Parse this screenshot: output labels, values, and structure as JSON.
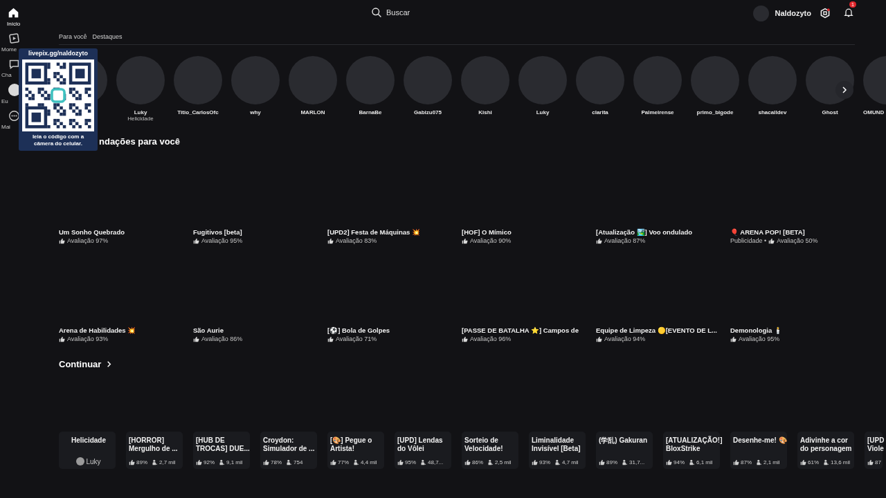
{
  "sidebar": {
    "items": [
      {
        "label": "Início",
        "selected": true
      },
      {
        "label": "Mome",
        "selected": false
      },
      {
        "label": "Cha",
        "selected": false
      },
      {
        "label": "Eu",
        "selected": false
      },
      {
        "label": "Mai",
        "selected": false
      }
    ]
  },
  "search": {
    "placeholder": "Buscar"
  },
  "user": {
    "name": "Naldozyto",
    "notifications": "1"
  },
  "tabs": [
    {
      "label": "Para você",
      "selected": false
    },
    {
      "label": "Destaques",
      "selected": false
    }
  ],
  "friends": [
    {
      "name": "Luky",
      "status": "Helicidade"
    },
    {
      "name": "Titio_CarlosOfc"
    },
    {
      "name": "why"
    },
    {
      "name": "MARLON"
    },
    {
      "name": "BarnaBe"
    },
    {
      "name": "Gabizu075"
    },
    {
      "name": "Kishi"
    },
    {
      "name": "Luky"
    },
    {
      "name": "clarita"
    },
    {
      "name": "Palmeirense"
    },
    {
      "name": "primo_bigode"
    },
    {
      "name": "shacalldev"
    },
    {
      "name": "Ghost"
    },
    {
      "name": "OMUND"
    }
  ],
  "recommended": {
    "title": "ndações para você",
    "games": [
      {
        "title": "Um Sonho Quebrado",
        "rating": "Avaliação 97%"
      },
      {
        "title": "Fugitivos [beta]",
        "rating": "Avaliação 95%"
      },
      {
        "title": "[UPD2] Festa de Máquinas 💥",
        "rating": "Avaliação 83%"
      },
      {
        "title": "[HOF] O Mímico",
        "rating": "Avaliação 90%"
      },
      {
        "title": "[Atualização 🏞️] Voo ondulado",
        "rating": "Avaliação 87%"
      },
      {
        "title": "🎈 ARENA POP! [BETA]",
        "ad": "Publicidade •",
        "rating": "Avaliação 50%"
      },
      {
        "title": "Arena de Habilidades 💥",
        "rating": "Avaliação 93%"
      },
      {
        "title": "São Aurie",
        "rating": "Avaliação 86%"
      },
      {
        "title": "[⚽] Bola de Golpes",
        "rating": "Avaliação 71%"
      },
      {
        "title": "[PASSE DE BATALHA ⭐] Campos de",
        "rating": "Avaliação 96%"
      },
      {
        "title": "Equipe de Limpeza 🟡[EVENTO DE L...",
        "rating": "Avaliação 94%"
      },
      {
        "title": "Demonologia 🕯️",
        "rating": "Avaliação 95%"
      }
    ]
  },
  "continue": {
    "title": "Continuar",
    "games": [
      {
        "kind": "friend",
        "title": "Helicidade",
        "friend": "Luky"
      },
      {
        "kind": "game",
        "title": "[HORROR] Mergulho de ...",
        "rating": "89%",
        "players": "2,7 mil"
      },
      {
        "kind": "game",
        "title": "[HUB DE TROCAS] DUE...",
        "rating": "92%",
        "players": "9,1 mil"
      },
      {
        "kind": "game",
        "title": "Croydon: Simulador de ...",
        "rating": "78%",
        "players": "754"
      },
      {
        "kind": "game",
        "title": "[🎨] Pegue o Artista!",
        "rating": "77%",
        "players": "4,4 mil"
      },
      {
        "kind": "game",
        "title": "[UPD] Lendas do Vôlei",
        "rating": "95%",
        "players": "48,7..."
      },
      {
        "kind": "game",
        "title": "Sorteio de Velocidade!",
        "rating": "86%",
        "players": "2,5 mil"
      },
      {
        "kind": "game",
        "title": "Liminalidade Invisível [Beta]",
        "rating": "93%",
        "players": "4,7 mil"
      },
      {
        "kind": "game",
        "title": "(学乱) Gakuran",
        "rating": "89%",
        "players": "31,7..."
      },
      {
        "kind": "game",
        "title": "[ATUALIZAÇÃO!] BloxStrike",
        "rating": "94%",
        "players": "6,1 mil"
      },
      {
        "kind": "game",
        "title": "Desenhe-me! 🎨",
        "rating": "87%",
        "players": "2,1 mil"
      },
      {
        "kind": "game",
        "title": "Adivinhe a cor do personagem",
        "rating": "61%",
        "players": "13,6 mil"
      },
      {
        "kind": "partial",
        "title": "[UPD Viole",
        "rating": "87"
      }
    ]
  },
  "overlay": {
    "link": "livepix.gg/naldozyto",
    "caption": "leia o código com a câmera do celular."
  }
}
